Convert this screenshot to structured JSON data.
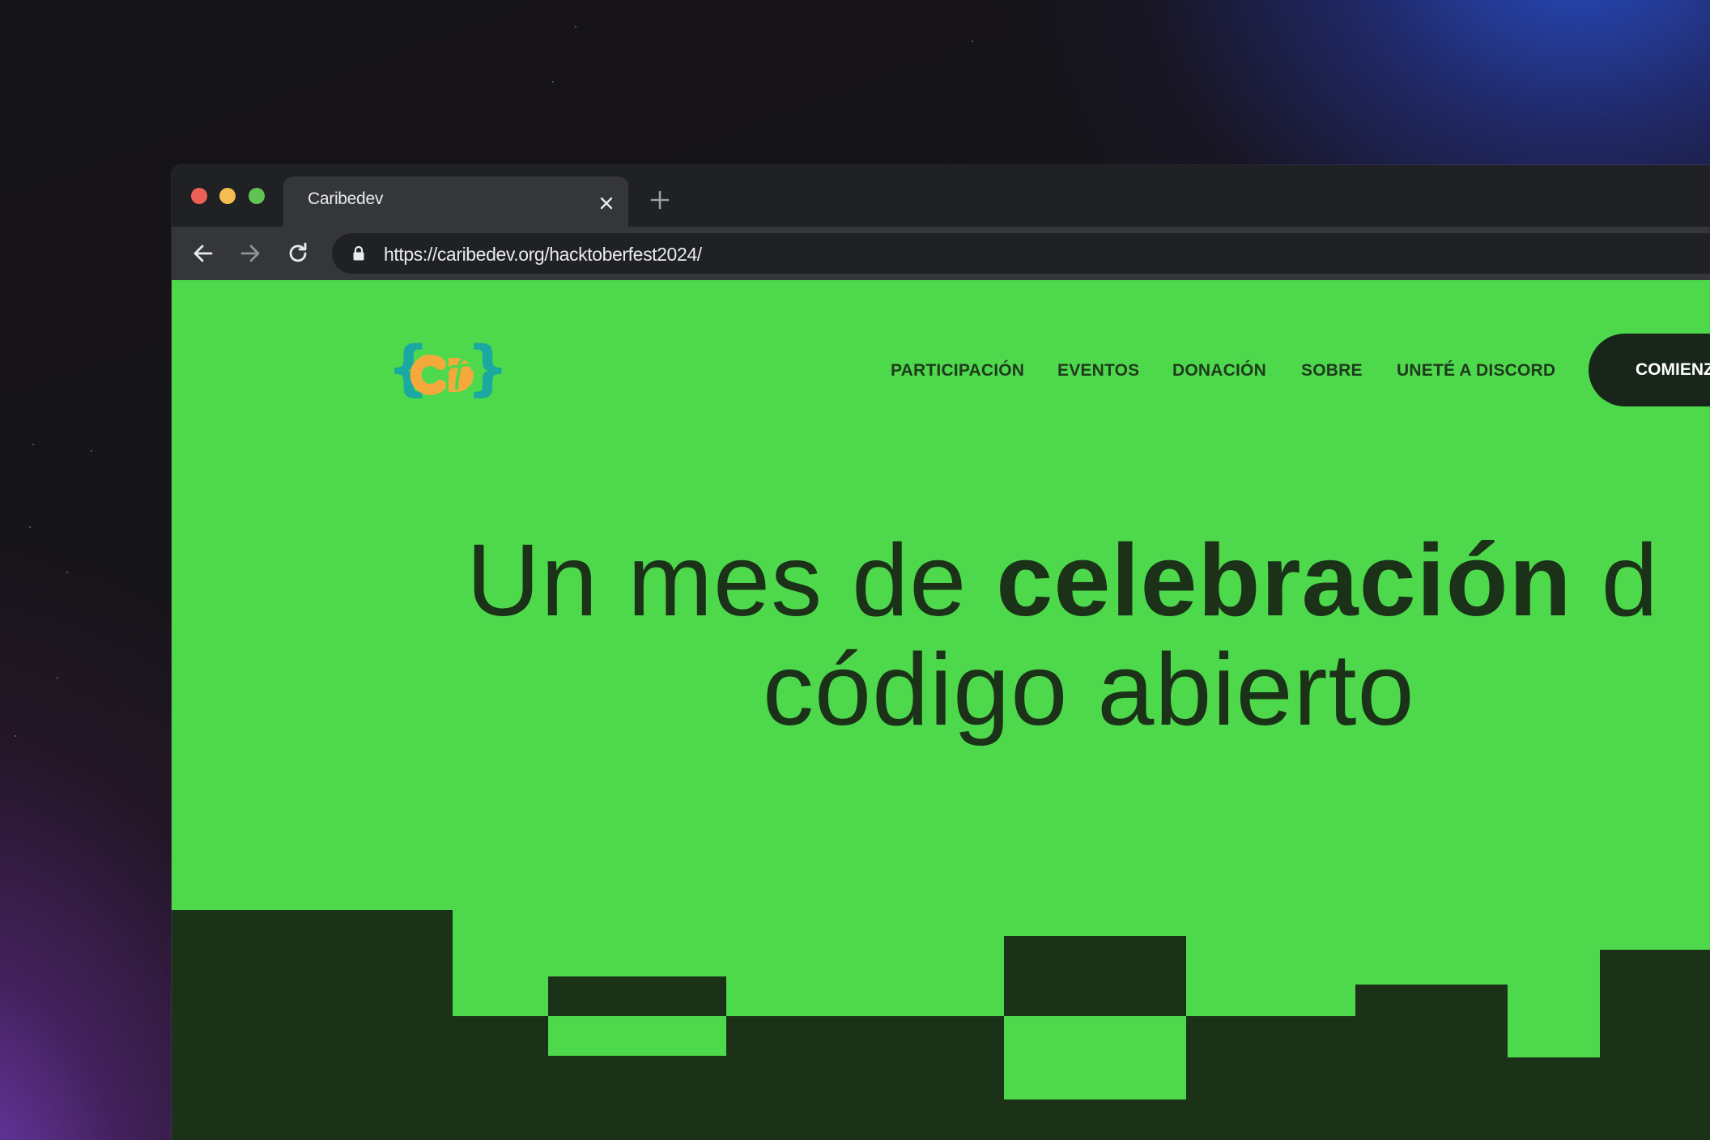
{
  "window": {
    "tab_title": "Caribedev",
    "url": "https://caribedev.org/hacktoberfest2024/"
  },
  "site": {
    "logo_text": "{CD}",
    "nav": [
      {
        "label": "PARTICIPACIÓN"
      },
      {
        "label": "EVENTOS"
      },
      {
        "label": "DONACIÓN"
      },
      {
        "label": "SOBRE"
      },
      {
        "label": "UNETÉ A DISCORD"
      }
    ],
    "cta_label": "COMIENZ",
    "hero": {
      "line1_a": "Un mes de ",
      "line1_b": "celebración",
      "line1_c": " d",
      "line2": "código abierto"
    }
  },
  "icons": {
    "tab_close": "close-icon",
    "new_tab": "plus-icon",
    "back": "arrow-left-icon",
    "forward": "arrow-right-icon",
    "reload": "reload-icon",
    "lock": "lock-icon"
  },
  "colors": {
    "page_green": "#4ed94c",
    "dark_green": "#1b3219",
    "cta_dark": "#18261a",
    "logo_orange": "#f5a93c",
    "logo_teal": "#1aa8a0",
    "browser_chrome": "#202124",
    "browser_toolbar": "#35363a"
  }
}
